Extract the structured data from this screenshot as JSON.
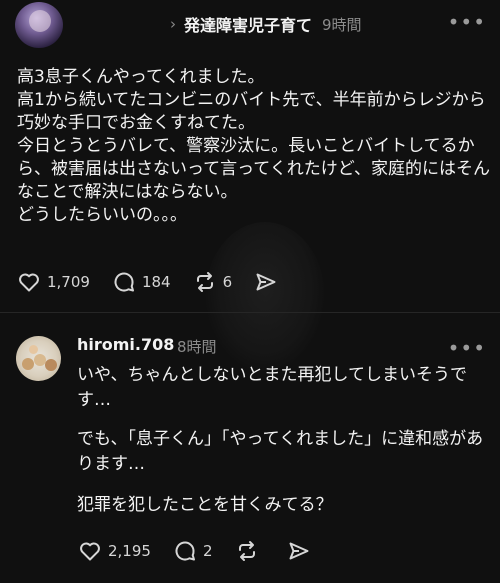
{
  "post": {
    "topic": "発達障害児子育て",
    "time": "9時間",
    "text": "高3息子くんやってくれました。\n高1から続いてたコンビニのバイト先で、半年前からレジから巧妙な手口でお金くすねてた。\n今日とうとうバレて、警察沙汰に。長いことバイトしてるから、被害届は出さないって言ってくれたけど、家庭的にはそんなことで解決にはならない。\nどうしたらいいの。。。",
    "likes": "1,709",
    "comments": "184",
    "reposts": "6"
  },
  "reply": {
    "username": "hiromi.708",
    "time": "8時間",
    "paragraph1": "いや、ちゃんとしないとまた再犯してしまいそうです…",
    "paragraph2": "でも、「息子くん」「やってくれました」に違和感があります…",
    "paragraph3": "犯罪を犯したことを甘くみてる？",
    "likes": "2,195",
    "comments": "2"
  },
  "colors": {
    "background": "#101010",
    "text": "#f3f3f3",
    "muted": "#8b8b8b"
  },
  "icons": [
    "more-icon",
    "chevron-right-icon",
    "heart-icon",
    "comment-icon",
    "repost-icon",
    "share-icon"
  ]
}
